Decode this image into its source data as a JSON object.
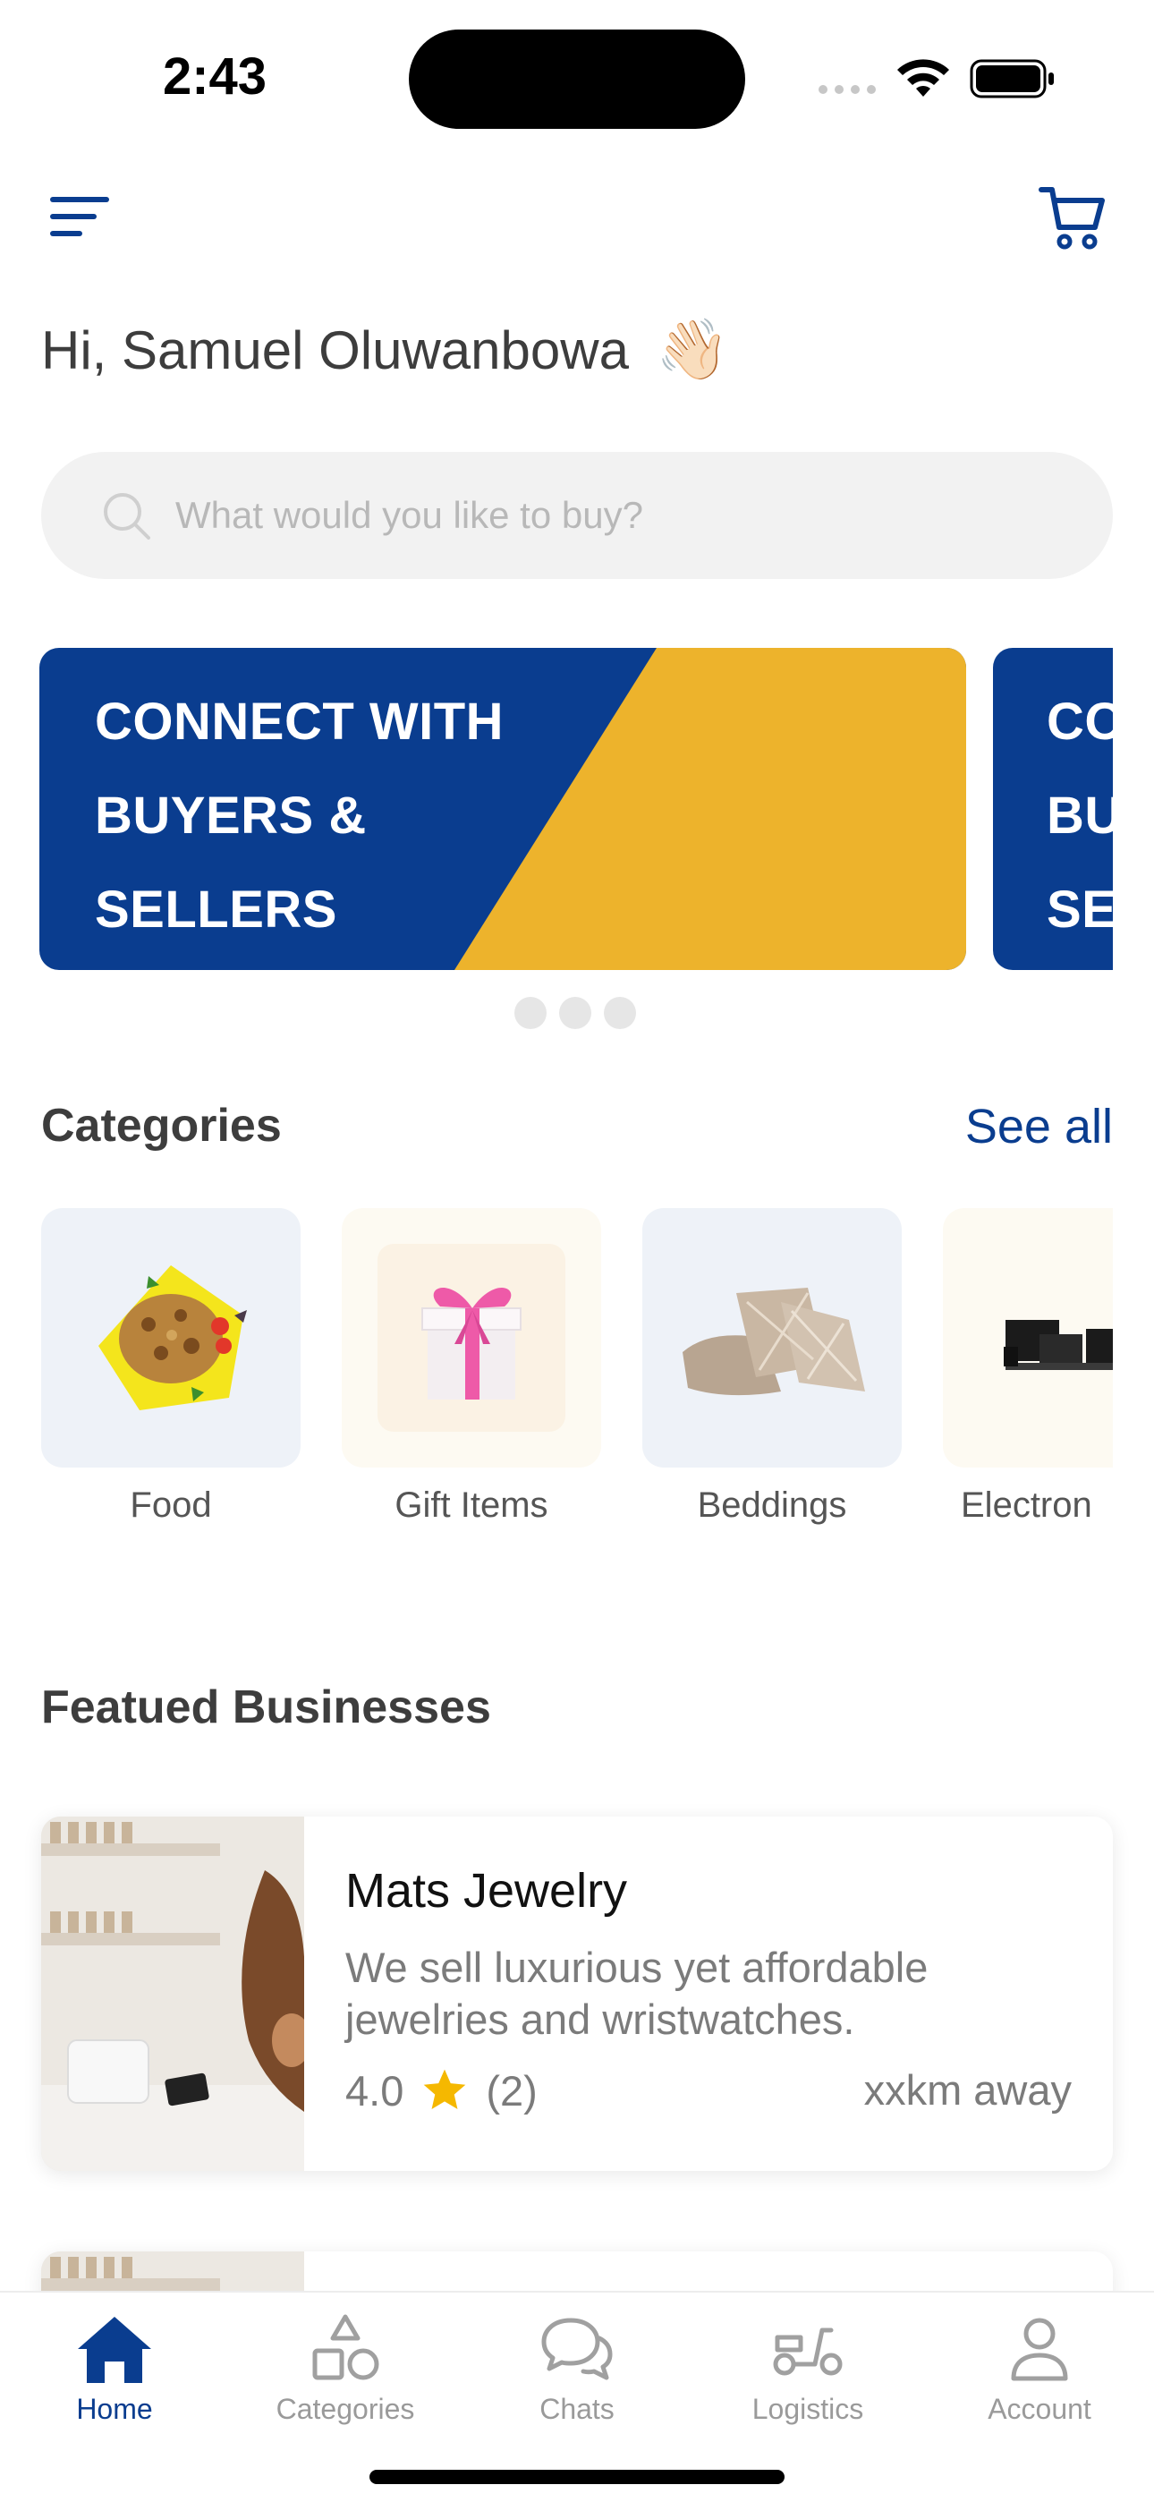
{
  "status_bar": {
    "time": "2:43"
  },
  "header": {
    "menu_icon": "hamburger-menu-icon",
    "cart_icon": "shopping-cart-icon"
  },
  "greeting": {
    "text": "Hi, Samuel Oluwanbowa",
    "emoji": "👋🏻"
  },
  "search": {
    "placeholder": "What would you like to buy?",
    "value": ""
  },
  "banners": [
    {
      "title": "CONNECT WITH BUYERS & SELLERS"
    },
    {
      "title": "CONNECT WITH BUYERS & SELLERS"
    }
  ],
  "carousel": {
    "pages": 3,
    "active": 0
  },
  "categories_section": {
    "title": "Categories",
    "see_all": "See all",
    "items": [
      {
        "label": "Food",
        "icon": "food-plate-icon"
      },
      {
        "label": "Gift Items",
        "icon": "gift-box-icon"
      },
      {
        "label": "Beddings",
        "icon": "pillows-icon"
      },
      {
        "label": "Electron",
        "icon": "electronics-icon"
      }
    ]
  },
  "featured_section": {
    "title": "Featued Businesses",
    "businesses": [
      {
        "name": "Mats Jewelry",
        "description": "We sell luxurious yet affordable jewelries and wristwatches.",
        "rating": "4.0",
        "reviews": "(2)",
        "distance": "xxkm away"
      }
    ]
  },
  "tabbar": {
    "items": [
      {
        "label": "Home",
        "icon": "home-icon",
        "active": true
      },
      {
        "label": "Categories",
        "icon": "shapes-icon",
        "active": false
      },
      {
        "label": "Chats",
        "icon": "chat-bubbles-icon",
        "active": false
      },
      {
        "label": "Logistics",
        "icon": "scooter-icon",
        "active": false
      },
      {
        "label": "Account",
        "icon": "user-icon",
        "active": false
      }
    ]
  },
  "colors": {
    "primary": "#0a3d8f",
    "accent": "#edb32c",
    "star": "#f5b800"
  }
}
